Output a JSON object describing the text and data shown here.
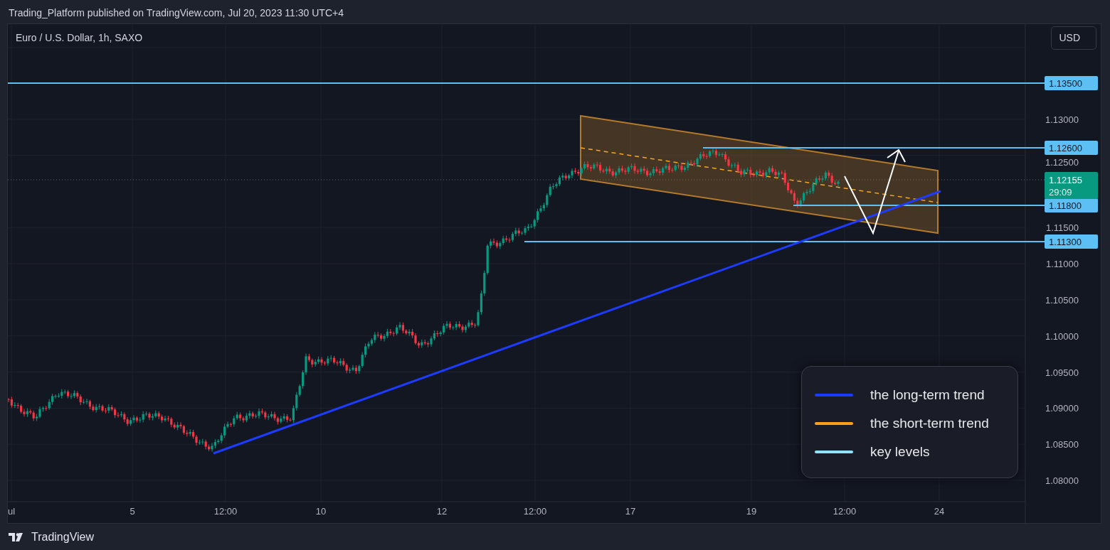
{
  "header": {
    "text": "Trading_Platform published on TradingView.com, Jul 20, 2023 11:30 UTC+4"
  },
  "chart": {
    "symbol": "Euro / U.S. Dollar, 1h, SAXO",
    "currency": "USD",
    "price_ticks": [
      "1.13000",
      "1.12500",
      "1.11500",
      "1.11000",
      "1.10500",
      "1.10000",
      "1.09500",
      "1.09000",
      "1.08500",
      "1.08000"
    ],
    "time_ticks": [
      "ul",
      "5",
      "12:00",
      "10",
      "12",
      "12:00",
      "17",
      "19",
      "12:00",
      "24"
    ],
    "key_levels": [
      {
        "label": "1.13500"
      },
      {
        "label": "1.12600"
      },
      {
        "label": "1.11800"
      },
      {
        "label": "1.11300"
      }
    ],
    "current_price": {
      "price": "1.12155",
      "countdown": "29:09"
    }
  },
  "legend": {
    "items": [
      {
        "label": "the long-term trend",
        "color": "#1a3cff"
      },
      {
        "label": "the short-term trend",
        "color": "#ff9f1a"
      },
      {
        "label": "key levels",
        "color": "#8fe3ff"
      }
    ]
  },
  "footer": {
    "brand": "TradingView"
  }
}
